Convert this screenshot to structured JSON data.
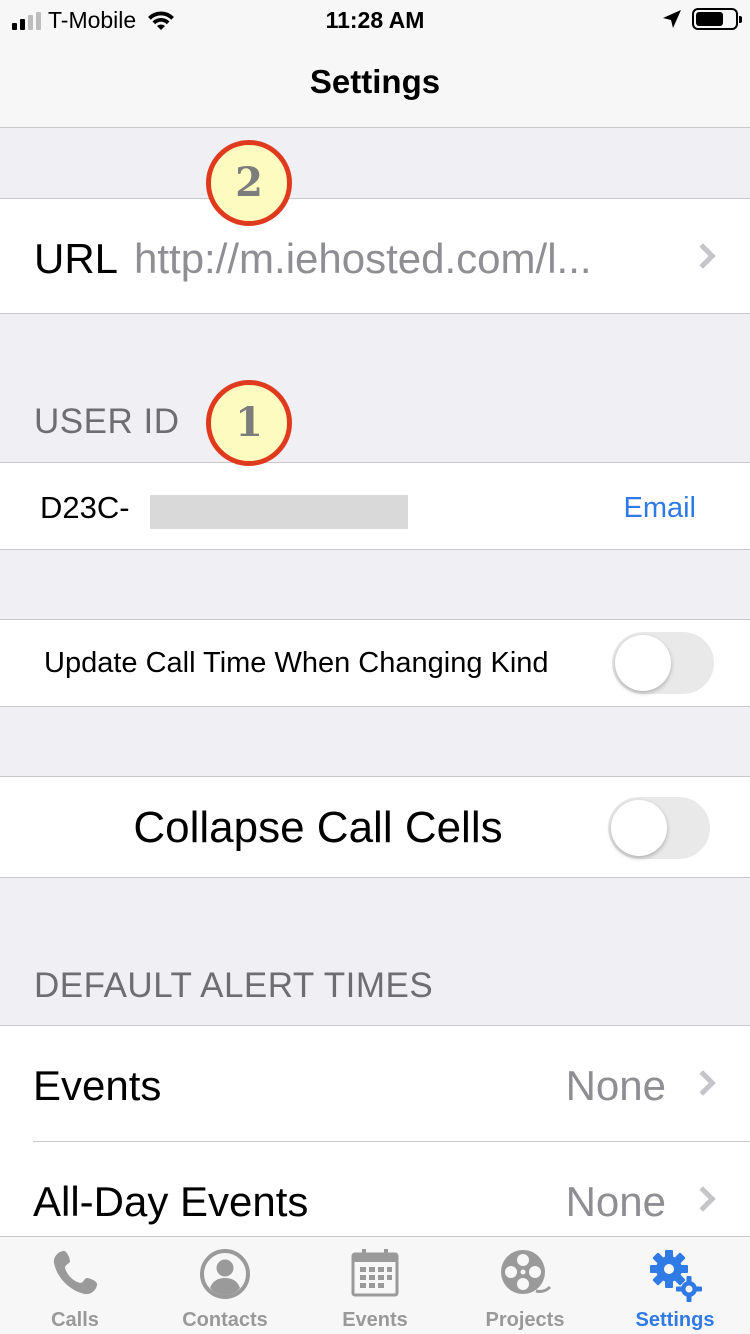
{
  "status_bar": {
    "carrier": "T-Mobile",
    "time": "11:28 AM"
  },
  "nav": {
    "title": "Settings"
  },
  "url_row": {
    "label": "URL",
    "value": "http://m.iehosted.com/l..."
  },
  "user_id": {
    "header": "USER ID",
    "value": "D23C-",
    "email_label": "Email"
  },
  "toggles": [
    {
      "label": "Update Call Time When Changing Kind",
      "on": false
    },
    {
      "label": "Collapse Call Cells",
      "on": false
    }
  ],
  "alerts": {
    "header": "DEFAULT ALERT TIMES",
    "rows": [
      {
        "label": "Events",
        "value": "None"
      },
      {
        "label": "All-Day Events",
        "value": "None"
      }
    ]
  },
  "annotations": {
    "badge_1": "1",
    "badge_2": "2"
  },
  "tab_bar": {
    "tabs": [
      {
        "label": "Calls",
        "icon": "phone-icon"
      },
      {
        "label": "Contacts",
        "icon": "contact-icon"
      },
      {
        "label": "Events",
        "icon": "calendar-icon"
      },
      {
        "label": "Projects",
        "icon": "film-reel-icon"
      },
      {
        "label": "Settings",
        "icon": "gears-icon"
      }
    ],
    "active_index": 4
  },
  "colors": {
    "accent": "#2f7ae5",
    "badge_border": "#e03a1e",
    "badge_fill": "#fdfbbf"
  }
}
